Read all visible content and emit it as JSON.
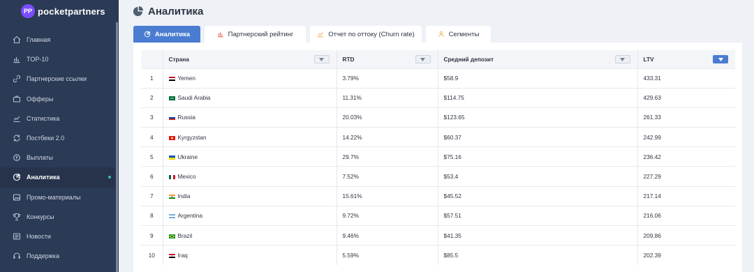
{
  "brand": {
    "name": "pocketpartners",
    "mark": "PP"
  },
  "sidebar": {
    "items": [
      {
        "label": "Главная",
        "icon": "home-icon",
        "active": false
      },
      {
        "label": "TOP-10",
        "icon": "bar-chart-icon",
        "active": false
      },
      {
        "label": "Партнерские ссылки",
        "icon": "link-icon",
        "active": false
      },
      {
        "label": "Офферы",
        "icon": "briefcase-icon",
        "active": false
      },
      {
        "label": "Статистика",
        "icon": "line-chart-icon",
        "active": false
      },
      {
        "label": "Постбеки 2.0",
        "icon": "sync-icon",
        "active": false
      },
      {
        "label": "Выплаты",
        "icon": "payout-icon",
        "active": false
      },
      {
        "label": "Аналитика",
        "icon": "pie-chart-icon",
        "active": true
      },
      {
        "label": "Промо-материалы",
        "icon": "image-icon",
        "active": false
      },
      {
        "label": "Конкурсы",
        "icon": "trophy-icon",
        "active": false
      },
      {
        "label": "Новости",
        "icon": "news-icon",
        "active": false
      },
      {
        "label": "Поддержка",
        "icon": "support-icon",
        "active": false
      }
    ]
  },
  "header": {
    "title": "Аналитика",
    "icon": "pie-chart-icon"
  },
  "tabs": [
    {
      "label": "Аналитика",
      "icon": "pie-chart-icon",
      "active": true
    },
    {
      "label": "Партнерский рейтинг",
      "icon": "bar-chart-icon",
      "active": false
    },
    {
      "label": "Отчет по оттоку (Churn rate)",
      "icon": "line-chart-icon",
      "active": false
    },
    {
      "label": "Сегменты",
      "icon": "segments-icon",
      "active": false
    }
  ],
  "table": {
    "columns": [
      "",
      "Страна",
      "RTD",
      "Средний депозит",
      "LTV"
    ],
    "sorted_column": "LTV",
    "rows": [
      {
        "n": "1",
        "country": "Yemen",
        "flag": "ye",
        "rtd": "3.79%",
        "avg_deposit": "$58.9",
        "ltv": "433.31"
      },
      {
        "n": "2",
        "country": "Saudi Arabia",
        "flag": "sa",
        "rtd": "11.31%",
        "avg_deposit": "$114.75",
        "ltv": "429.63"
      },
      {
        "n": "3",
        "country": "Russia",
        "flag": "ru",
        "rtd": "20.03%",
        "avg_deposit": "$123.65",
        "ltv": "261.33"
      },
      {
        "n": "4",
        "country": "Kyrgyzstan",
        "flag": "kg",
        "rtd": "14.22%",
        "avg_deposit": "$60.37",
        "ltv": "242.99"
      },
      {
        "n": "5",
        "country": "Ukraine",
        "flag": "ua",
        "rtd": "29.7%",
        "avg_deposit": "$75.16",
        "ltv": "236.42"
      },
      {
        "n": "6",
        "country": "Mexico",
        "flag": "mx",
        "rtd": "7.52%",
        "avg_deposit": "$53.4",
        "ltv": "227.29"
      },
      {
        "n": "7",
        "country": "India",
        "flag": "in",
        "rtd": "15.61%",
        "avg_deposit": "$45.52",
        "ltv": "217.14"
      },
      {
        "n": "8",
        "country": "Argentina",
        "flag": "ar",
        "rtd": "9.72%",
        "avg_deposit": "$57.51",
        "ltv": "216.06"
      },
      {
        "n": "9",
        "country": "Brazil",
        "flag": "br",
        "rtd": "9.46%",
        "avg_deposit": "$41.35",
        "ltv": "209.86"
      },
      {
        "n": "10",
        "country": "Iraq",
        "flag": "iq",
        "rtd": "5.59%",
        "avg_deposit": "$85.5",
        "ltv": "202.39"
      }
    ]
  },
  "colors": {
    "sidebar_bg": "#2b3a55",
    "accent": "#4a7dd1",
    "active_dot": "#35c2a0",
    "tab_icon_red": "#e0533f",
    "tab_icon_orange": "#f0a13a"
  }
}
